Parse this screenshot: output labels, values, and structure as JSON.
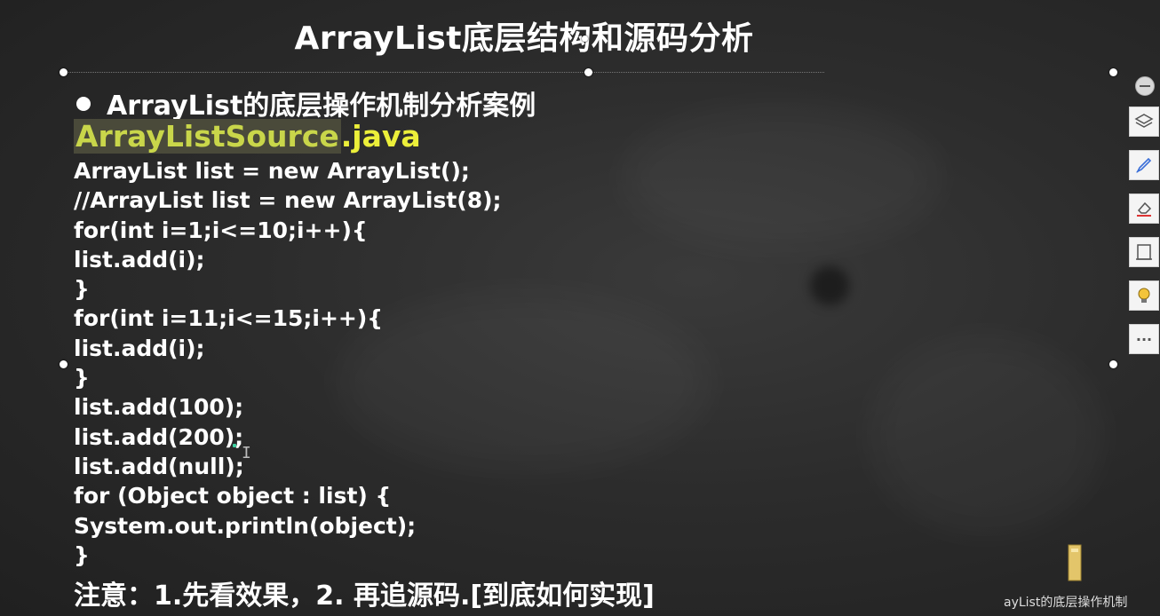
{
  "slide": {
    "title": "ArrayList底层结构和源码分析",
    "heading": "ArrayList的底层操作机制分析案例",
    "file_name": "ArrayListSource",
    "file_ext": ".java",
    "code_lines": [
      "ArrayList list = new ArrayList();",
      "//ArrayList list = new ArrayList(8);",
      "for(int i=1;i<=10;i++){",
      "list.add(i);",
      "}",
      "for(int i=11;i<=15;i++){",
      "list.add(i);",
      "}",
      "list.add(100);",
      "list.add(200);",
      "list.add(null);",
      "for (Object object : list) {",
      "System.out.println(object);",
      "}"
    ],
    "note": "注意：1.先看效果，2. 再追源码.[到底如何实现]"
  },
  "toolbar": {
    "items": [
      "collapse-icon",
      "layers-icon",
      "pen-icon",
      "eraser-icon",
      "frame-icon",
      "lightbulb-icon",
      "more-icon"
    ],
    "more_label": "···"
  },
  "taskbar": {
    "label": "ayList的底层操作机制"
  },
  "colors": {
    "background": "#2c2c2c",
    "filename_highlight": "#c9d64a",
    "file_ext": "#ecef3a"
  }
}
